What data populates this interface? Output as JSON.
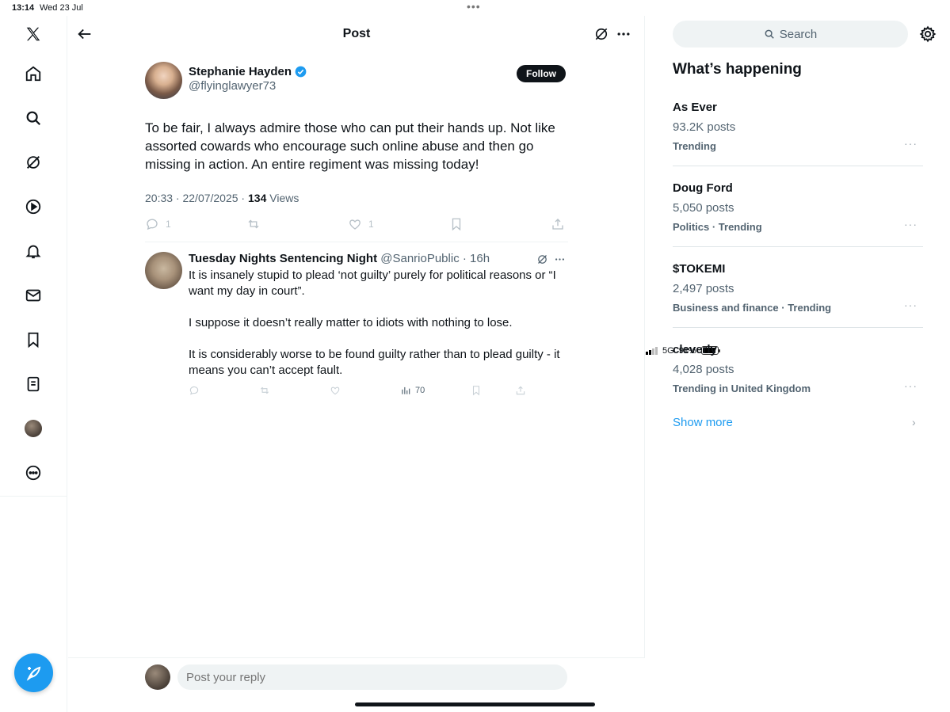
{
  "status": {
    "time": "13:14",
    "date": "Wed 23 Jul",
    "network": "5G",
    "battery": "91%",
    "battery_level": 0.91
  },
  "nav": {
    "items": [
      "x-logo",
      "home",
      "explore",
      "grok",
      "video",
      "notifications",
      "messages",
      "bookmarks",
      "lists",
      "profile",
      "more"
    ],
    "compose_label": "Post"
  },
  "header": {
    "title": "Post"
  },
  "tweet": {
    "author_name": "Stephanie Hayden",
    "handle": "@flyinglawyer73",
    "follow_label": "Follow",
    "text": "To be fair, I always admire those who can put their hands up. Not like assorted cowards who encourage such online abuse and then go missing in action. An entire regiment was missing today!",
    "timestamp": "20:33 · 22/07/2025 · ",
    "views_count": "134",
    "views_label": " Views",
    "reply_count": "1",
    "like_count": "1"
  },
  "reply": {
    "author_name": "Tuesday Nights Sentencing Night",
    "handle": "@SanrioPublic",
    "time": "· 16h",
    "para1": "It is insanely stupid to plead ‘not guilty’ purely for political reasons or “I want my day in court”.",
    "para2": "I suppose it doesn’t really matter to idiots with nothing to lose.",
    "para3": "It is considerably worse to be found guilty rather than to plead guilty - it means you can’t accept fault.",
    "views": "70"
  },
  "reply_box": {
    "placeholder": "Post your reply"
  },
  "sidebar": {
    "search_placeholder": "Search",
    "title": "What’s happening",
    "trends": [
      {
        "name": "As Ever",
        "posts": "93.2K posts",
        "category": "Trending"
      },
      {
        "name": "Doug Ford",
        "posts": "5,050 posts",
        "category": "Politics · Trending"
      },
      {
        "name": "$TOKEMI",
        "posts": "2,497 posts",
        "category": "Business and finance · Trending"
      },
      {
        "name": "cleverly",
        "posts": "4,028 posts",
        "category": "Trending in United Kingdom"
      }
    ],
    "show_more": "Show more"
  },
  "colors": {
    "accent": "#1d9bf0",
    "text": "#0f1419",
    "muted": "#536471"
  }
}
